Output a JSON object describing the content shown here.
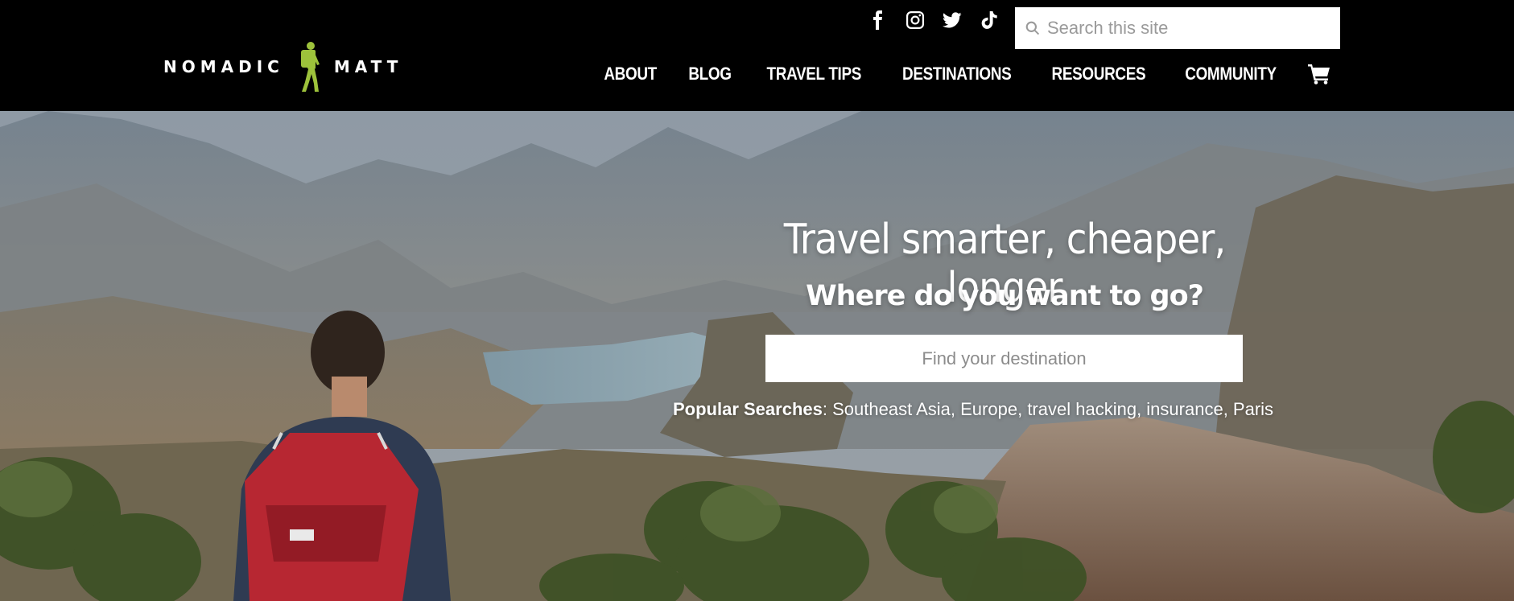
{
  "header": {
    "logo": {
      "left_word": "NOMADIC",
      "right_word": "MATT"
    },
    "social": [
      {
        "icon": "facebook-icon"
      },
      {
        "icon": "instagram-icon"
      },
      {
        "icon": "twitter-icon"
      },
      {
        "icon": "tiktok-icon"
      }
    ],
    "search": {
      "placeholder": "Search this site",
      "value": ""
    },
    "nav": [
      "ABOUT",
      "BLOG",
      "TRAVEL TIPS",
      "DESTINATIONS",
      "RESOURCES",
      "COMMUNITY"
    ],
    "cart_icon": "cart-icon"
  },
  "hero": {
    "title": "Travel smarter, cheaper, longer",
    "subtitle": "Where do you want to go?",
    "destination_search": {
      "placeholder": "Find your destination",
      "value": ""
    },
    "popular": {
      "label": "Popular Searches",
      "separator": ":",
      "items": [
        "Southeast Asia",
        "Europe",
        "travel hacking",
        "insurance",
        "Paris"
      ]
    }
  },
  "colors": {
    "logo_accent": "#9dc23b",
    "header_bg": "#000000"
  }
}
